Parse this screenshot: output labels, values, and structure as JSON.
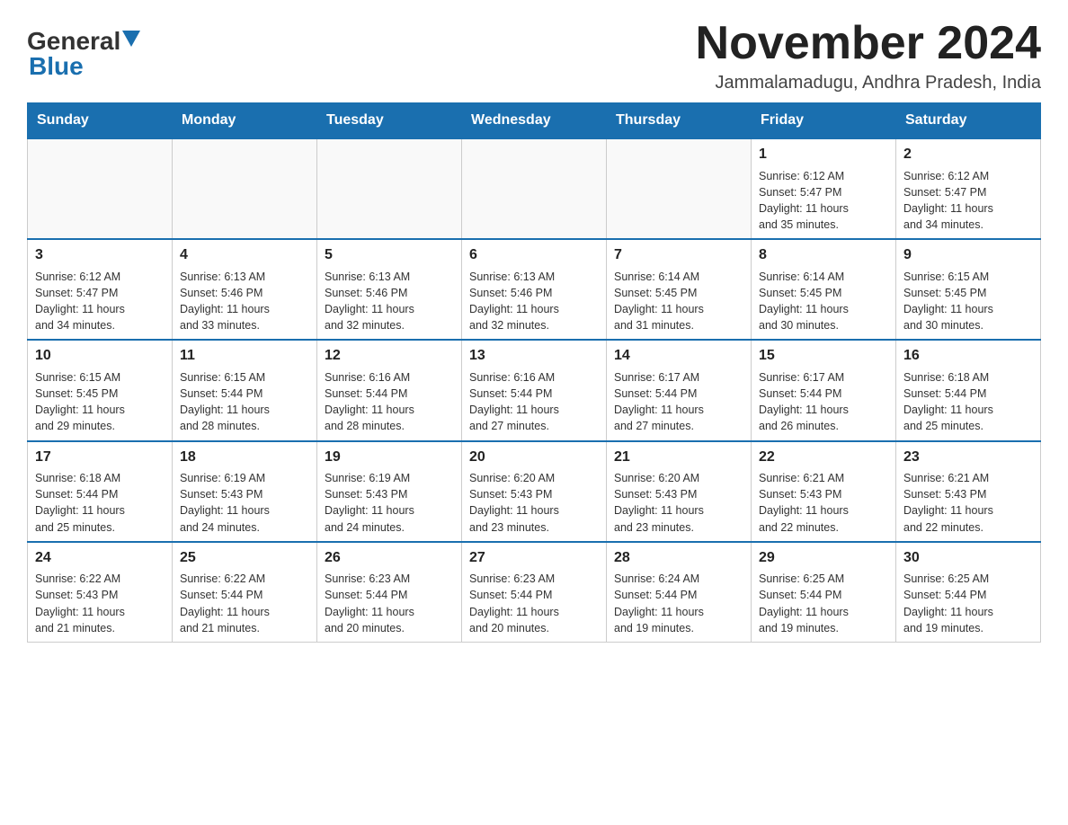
{
  "header": {
    "logo_general": "General",
    "logo_blue": "Blue",
    "month_title": "November 2024",
    "location": "Jammalamadugu, Andhra Pradesh, India"
  },
  "days_of_week": [
    "Sunday",
    "Monday",
    "Tuesday",
    "Wednesday",
    "Thursday",
    "Friday",
    "Saturday"
  ],
  "weeks": [
    [
      {
        "day": "",
        "info": ""
      },
      {
        "day": "",
        "info": ""
      },
      {
        "day": "",
        "info": ""
      },
      {
        "day": "",
        "info": ""
      },
      {
        "day": "",
        "info": ""
      },
      {
        "day": "1",
        "info": "Sunrise: 6:12 AM\nSunset: 5:47 PM\nDaylight: 11 hours\nand 35 minutes."
      },
      {
        "day": "2",
        "info": "Sunrise: 6:12 AM\nSunset: 5:47 PM\nDaylight: 11 hours\nand 34 minutes."
      }
    ],
    [
      {
        "day": "3",
        "info": "Sunrise: 6:12 AM\nSunset: 5:47 PM\nDaylight: 11 hours\nand 34 minutes."
      },
      {
        "day": "4",
        "info": "Sunrise: 6:13 AM\nSunset: 5:46 PM\nDaylight: 11 hours\nand 33 minutes."
      },
      {
        "day": "5",
        "info": "Sunrise: 6:13 AM\nSunset: 5:46 PM\nDaylight: 11 hours\nand 32 minutes."
      },
      {
        "day": "6",
        "info": "Sunrise: 6:13 AM\nSunset: 5:46 PM\nDaylight: 11 hours\nand 32 minutes."
      },
      {
        "day": "7",
        "info": "Sunrise: 6:14 AM\nSunset: 5:45 PM\nDaylight: 11 hours\nand 31 minutes."
      },
      {
        "day": "8",
        "info": "Sunrise: 6:14 AM\nSunset: 5:45 PM\nDaylight: 11 hours\nand 30 minutes."
      },
      {
        "day": "9",
        "info": "Sunrise: 6:15 AM\nSunset: 5:45 PM\nDaylight: 11 hours\nand 30 minutes."
      }
    ],
    [
      {
        "day": "10",
        "info": "Sunrise: 6:15 AM\nSunset: 5:45 PM\nDaylight: 11 hours\nand 29 minutes."
      },
      {
        "day": "11",
        "info": "Sunrise: 6:15 AM\nSunset: 5:44 PM\nDaylight: 11 hours\nand 28 minutes."
      },
      {
        "day": "12",
        "info": "Sunrise: 6:16 AM\nSunset: 5:44 PM\nDaylight: 11 hours\nand 28 minutes."
      },
      {
        "day": "13",
        "info": "Sunrise: 6:16 AM\nSunset: 5:44 PM\nDaylight: 11 hours\nand 27 minutes."
      },
      {
        "day": "14",
        "info": "Sunrise: 6:17 AM\nSunset: 5:44 PM\nDaylight: 11 hours\nand 27 minutes."
      },
      {
        "day": "15",
        "info": "Sunrise: 6:17 AM\nSunset: 5:44 PM\nDaylight: 11 hours\nand 26 minutes."
      },
      {
        "day": "16",
        "info": "Sunrise: 6:18 AM\nSunset: 5:44 PM\nDaylight: 11 hours\nand 25 minutes."
      }
    ],
    [
      {
        "day": "17",
        "info": "Sunrise: 6:18 AM\nSunset: 5:44 PM\nDaylight: 11 hours\nand 25 minutes."
      },
      {
        "day": "18",
        "info": "Sunrise: 6:19 AM\nSunset: 5:43 PM\nDaylight: 11 hours\nand 24 minutes."
      },
      {
        "day": "19",
        "info": "Sunrise: 6:19 AM\nSunset: 5:43 PM\nDaylight: 11 hours\nand 24 minutes."
      },
      {
        "day": "20",
        "info": "Sunrise: 6:20 AM\nSunset: 5:43 PM\nDaylight: 11 hours\nand 23 minutes."
      },
      {
        "day": "21",
        "info": "Sunrise: 6:20 AM\nSunset: 5:43 PM\nDaylight: 11 hours\nand 23 minutes."
      },
      {
        "day": "22",
        "info": "Sunrise: 6:21 AM\nSunset: 5:43 PM\nDaylight: 11 hours\nand 22 minutes."
      },
      {
        "day": "23",
        "info": "Sunrise: 6:21 AM\nSunset: 5:43 PM\nDaylight: 11 hours\nand 22 minutes."
      }
    ],
    [
      {
        "day": "24",
        "info": "Sunrise: 6:22 AM\nSunset: 5:43 PM\nDaylight: 11 hours\nand 21 minutes."
      },
      {
        "day": "25",
        "info": "Sunrise: 6:22 AM\nSunset: 5:44 PM\nDaylight: 11 hours\nand 21 minutes."
      },
      {
        "day": "26",
        "info": "Sunrise: 6:23 AM\nSunset: 5:44 PM\nDaylight: 11 hours\nand 20 minutes."
      },
      {
        "day": "27",
        "info": "Sunrise: 6:23 AM\nSunset: 5:44 PM\nDaylight: 11 hours\nand 20 minutes."
      },
      {
        "day": "28",
        "info": "Sunrise: 6:24 AM\nSunset: 5:44 PM\nDaylight: 11 hours\nand 19 minutes."
      },
      {
        "day": "29",
        "info": "Sunrise: 6:25 AM\nSunset: 5:44 PM\nDaylight: 11 hours\nand 19 minutes."
      },
      {
        "day": "30",
        "info": "Sunrise: 6:25 AM\nSunset: 5:44 PM\nDaylight: 11 hours\nand 19 minutes."
      }
    ]
  ]
}
